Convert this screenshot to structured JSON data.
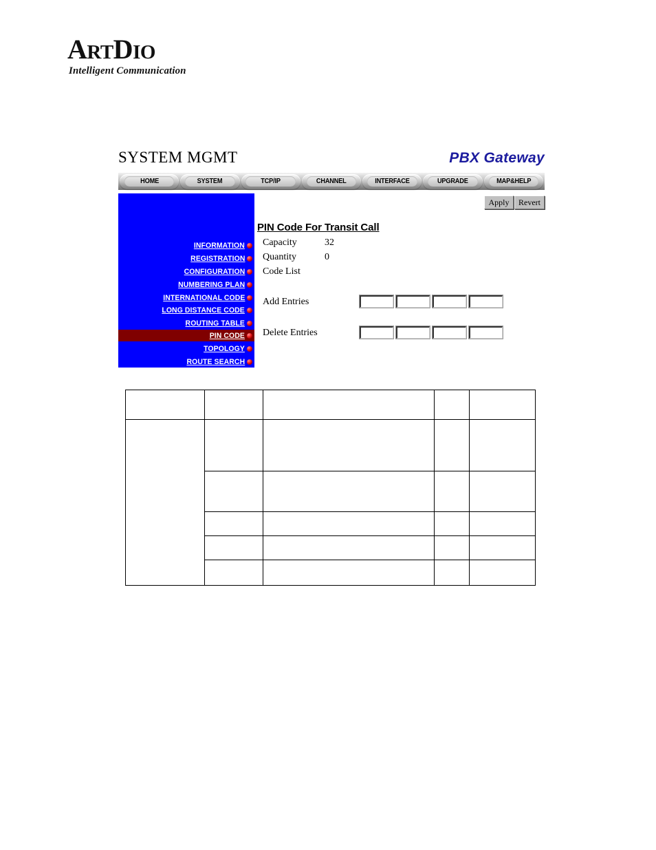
{
  "logo": {
    "word_part1": "A",
    "word_part2": "RT",
    "word_part3": "D",
    "word_part4": "IO",
    "tagline": "Intelligent Communication"
  },
  "header": {
    "title": "SYSTEM MGMT",
    "product": "PBX Gateway"
  },
  "nav": {
    "tabs": [
      {
        "label": "HOME"
      },
      {
        "label": "SYSTEM"
      },
      {
        "label": "TCP/IP"
      },
      {
        "label": "CHANNEL"
      },
      {
        "label": "INTERFACE"
      },
      {
        "label": "UPGRADE"
      },
      {
        "label": "MAP&HELP"
      }
    ]
  },
  "sidebar": {
    "background_color": "#0000ff",
    "active_color": "#800000",
    "items": [
      {
        "label": "INFORMATION",
        "active": false
      },
      {
        "label": "REGISTRATION",
        "active": false
      },
      {
        "label": "CONFIGURATION",
        "active": false
      },
      {
        "label": "NUMBERING PLAN",
        "active": false
      },
      {
        "label": "INTERNATIONAL CODE",
        "active": false
      },
      {
        "label": "LONG DISTANCE CODE",
        "active": false
      },
      {
        "label": "ROUTING TABLE",
        "active": false
      },
      {
        "label": "PIN CODE",
        "active": true
      },
      {
        "label": "TOPOLOGY",
        "active": false
      },
      {
        "label": "ROUTE SEARCH",
        "active": false
      }
    ]
  },
  "toolbar": {
    "apply_label": "Apply",
    "revert_label": "Revert"
  },
  "form": {
    "title": "PIN Code For Transit Call",
    "capacity_label": "Capacity",
    "capacity_value": "32",
    "quantity_label": "Quantity",
    "quantity_value": "0",
    "code_list_label": "Code List",
    "code_list_value": "",
    "add_entries_label": "Add Entries",
    "delete_entries_label": "Delete Entries",
    "add_entries_values": [
      "",
      "",
      "",
      ""
    ],
    "delete_entries_values": [
      "",
      "",
      "",
      ""
    ]
  },
  "data_table": {
    "header": [
      "",
      "",
      "",
      "",
      ""
    ],
    "rows": [
      [
        "",
        "",
        "",
        "",
        ""
      ],
      [
        "",
        "",
        "",
        ""
      ],
      [
        "",
        "",
        "",
        ""
      ],
      [
        "",
        "",
        "",
        ""
      ],
      [
        "",
        "",
        "",
        ""
      ]
    ]
  }
}
